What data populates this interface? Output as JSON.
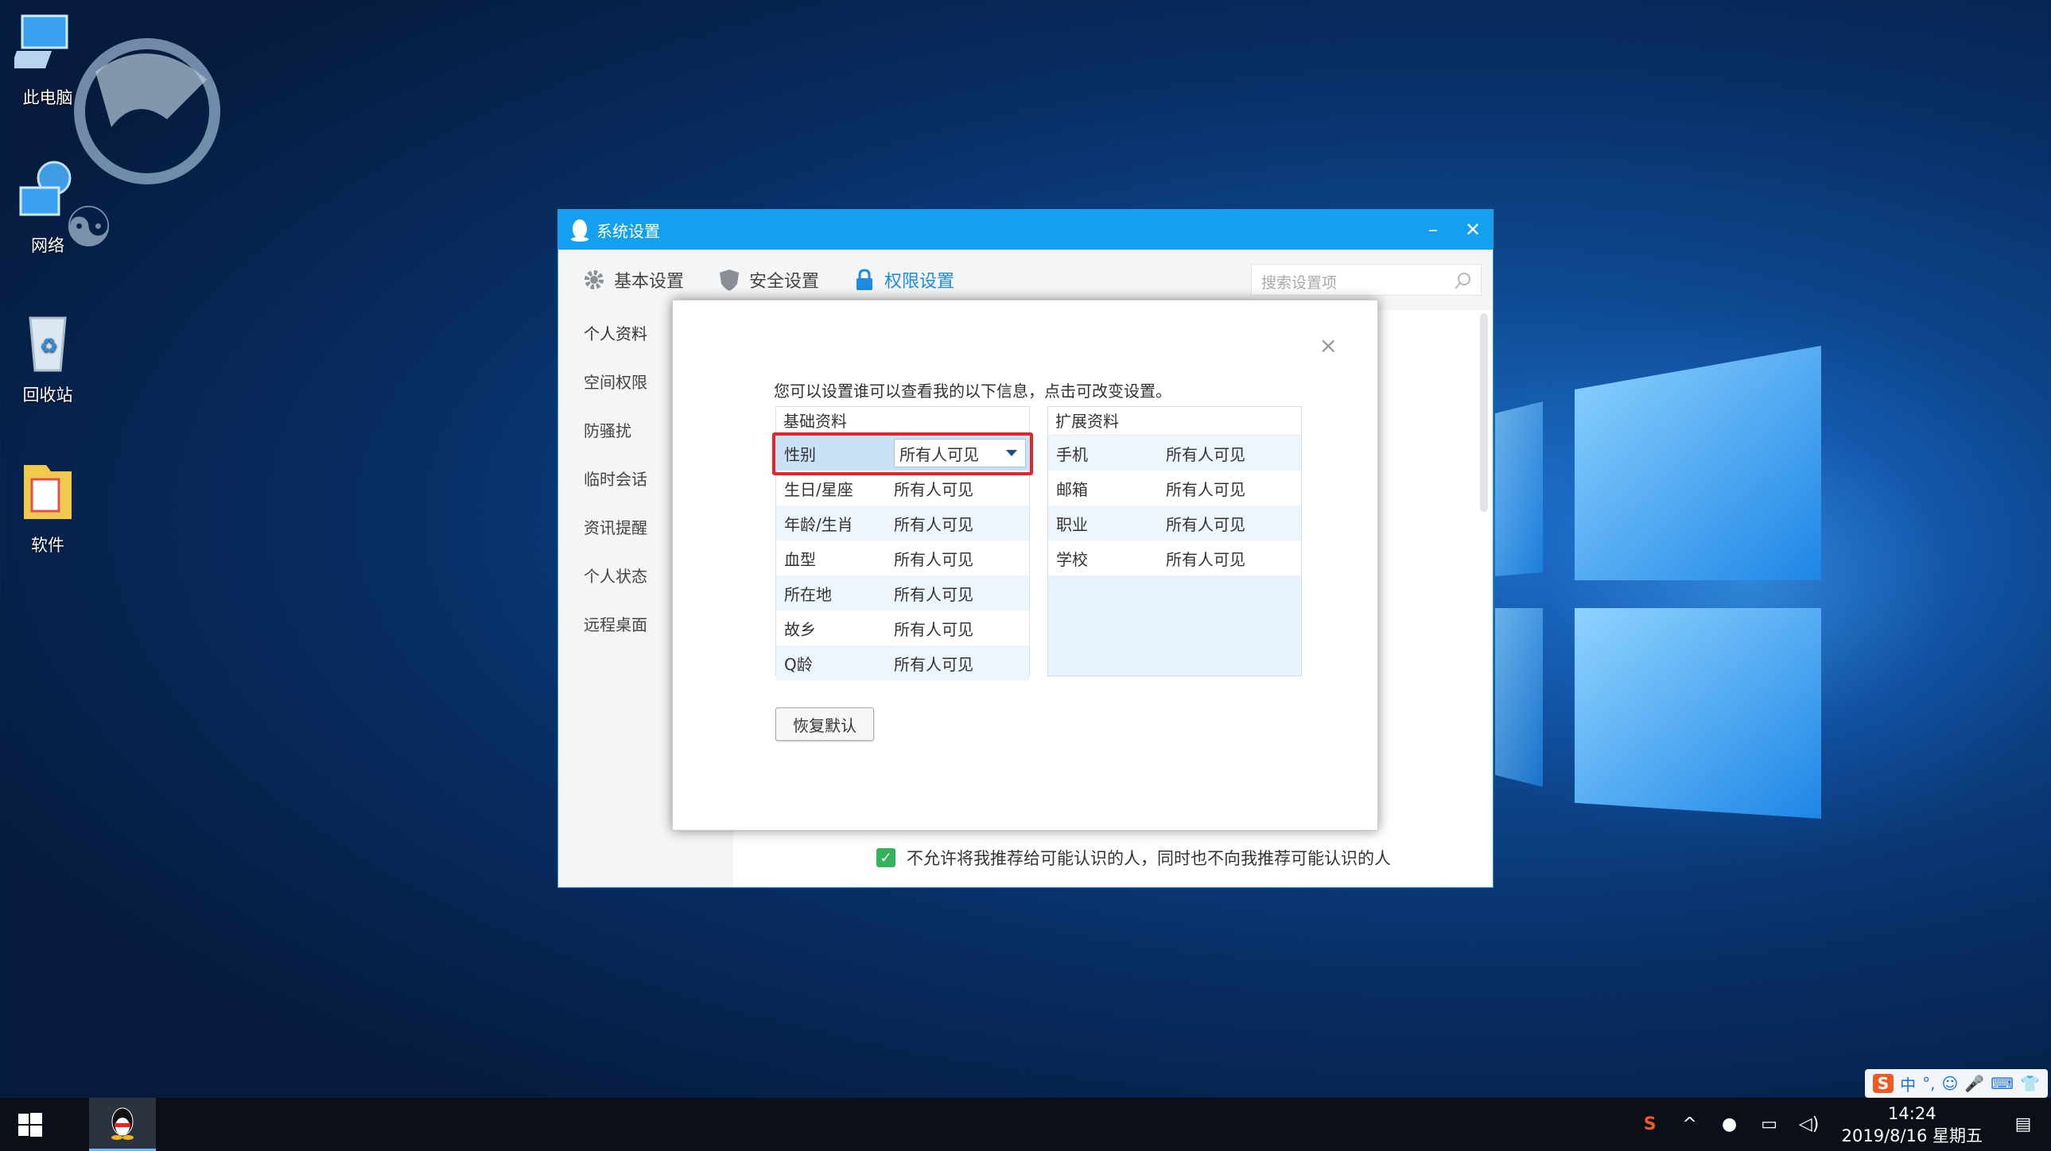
{
  "desktop": {
    "icons": [
      {
        "label": "此电脑",
        "icon": "computer-icon"
      },
      {
        "label": "网络",
        "icon": "network-icon"
      },
      {
        "label": "回收站",
        "icon": "recycle-bin-icon"
      },
      {
        "label": "软件",
        "icon": "folder-icon"
      }
    ]
  },
  "window": {
    "title": "系统设置",
    "minimize": "–",
    "close": "✕",
    "tabs": [
      {
        "label": "基本设置",
        "icon": "gear-icon"
      },
      {
        "label": "安全设置",
        "icon": "shield-icon"
      },
      {
        "label": "权限设置",
        "icon": "lock-icon",
        "active": true
      }
    ],
    "search_placeholder": "搜索设置项",
    "sidebar": [
      {
        "label": "个人资料"
      },
      {
        "label": "空间权限"
      },
      {
        "label": "防骚扰"
      },
      {
        "label": "临时会话"
      },
      {
        "label": "资讯提醒"
      },
      {
        "label": "个人状态"
      },
      {
        "label": "远程桌面"
      }
    ],
    "bottom_option": "不允许将我推荐给可能认识的人，同时也不向我推荐可能认识的人"
  },
  "dialog": {
    "close": "×",
    "description": "您可以设置谁可以查看我的以下信息，点击可改变设置。",
    "basic": {
      "title": "基础资料",
      "rows": [
        {
          "key": "性别",
          "value": "所有人可见"
        },
        {
          "key": "生日/星座",
          "value": "所有人可见"
        },
        {
          "key": "年龄/生肖",
          "value": "所有人可见"
        },
        {
          "key": "血型",
          "value": "所有人可见"
        },
        {
          "key": "所在地",
          "value": "所有人可见"
        },
        {
          "key": "故乡",
          "value": "所有人可见"
        },
        {
          "key": "Q龄",
          "value": "所有人可见"
        }
      ]
    },
    "extended": {
      "title": "扩展资料",
      "rows": [
        {
          "key": "手机",
          "value": "所有人可见"
        },
        {
          "key": "邮箱",
          "value": "所有人可见"
        },
        {
          "key": "职业",
          "value": "所有人可见"
        },
        {
          "key": "学校",
          "value": "所有人可见"
        }
      ]
    },
    "restore_button": "恢复默认"
  },
  "taskbar": {
    "ime": [
      "中",
      "°,",
      "☺",
      "🎤",
      "⌨",
      "👕"
    ],
    "time": "14:24",
    "date": "2019/8/16 星期五"
  },
  "colors": {
    "title_bar": "#12a0ef",
    "active_tab": "#1e8be0",
    "highlight": "#e3262c"
  }
}
